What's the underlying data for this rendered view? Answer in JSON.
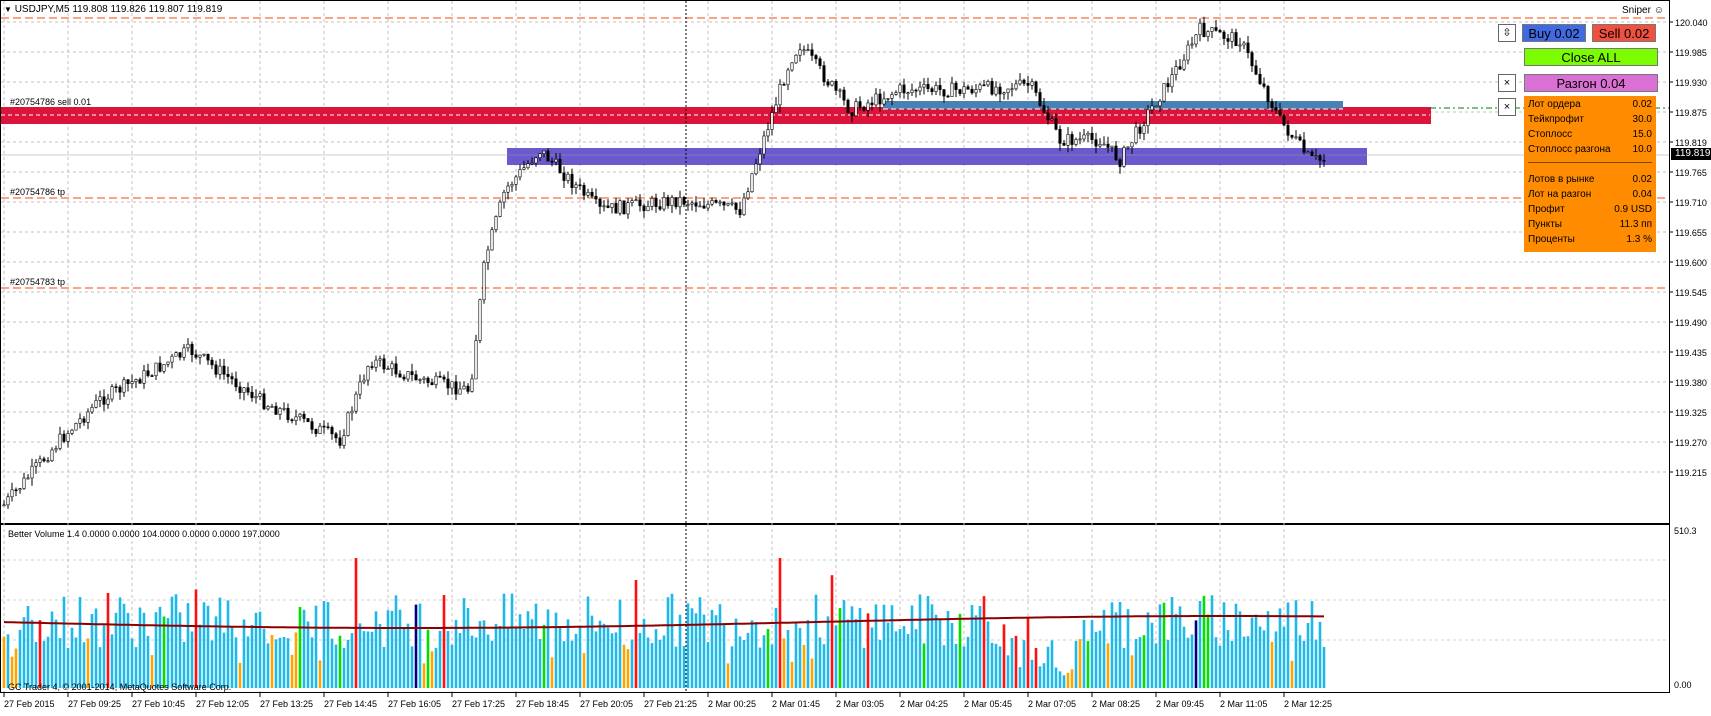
{
  "header": {
    "symbol_info": "USDJPY,M5  119.808 119.826 119.807 119.819",
    "expert_name": "Sniper"
  },
  "price_axis": {
    "labels": [
      "120.040",
      "119.985",
      "119.930",
      "119.875",
      "119.819",
      "119.765",
      "119.710",
      "119.655",
      "119.600",
      "119.545",
      "119.490",
      "119.435",
      "119.380",
      "119.325",
      "119.270",
      "119.215"
    ],
    "current_price": "119.819"
  },
  "time_axis": {
    "labels": [
      "27 Feb 2015",
      "27 Feb 09:25",
      "27 Feb 10:45",
      "27 Feb 12:05",
      "27 Feb 13:25",
      "27 Feb 14:45",
      "27 Feb 16:05",
      "27 Feb 17:25",
      "27 Feb 18:45",
      "27 Feb 20:05",
      "27 Feb 21:25",
      "2 Mar 00:25",
      "2 Mar 01:45",
      "2 Mar 03:05",
      "2 Mar 04:25",
      "2 Mar 05:45",
      "2 Mar 07:05",
      "2 Mar 08:25",
      "2 Mar 09:45",
      "2 Mar 11:05",
      "2 Mar 12:25"
    ]
  },
  "order_labels": {
    "sell_order": "#20754786 sell 0.01",
    "tp_1": "#20754786 tp",
    "tp_2": "#20754783 tp"
  },
  "volume_indicator": {
    "title": "Better Volume 1.4 0.0000 0.0000 104.0000 0.0000 0.0000 197.0000",
    "max_label": "510.3",
    "min_label": "0.00",
    "copyright": "GC Trader 4, © 2001-2014, MetaQuotes Software Corp."
  },
  "trade_panel": {
    "buy_label": "Buy 0.02",
    "sell_label": "Sell 0.02",
    "close_all_label": "Close ALL",
    "razgon_label": "Разгон 0.04",
    "close_x": "×",
    "arrows_icon": "⇳"
  },
  "info_panel": {
    "rows_top": [
      {
        "label": "Лот ордера",
        "value": "0.02"
      },
      {
        "label": "Тейкпрофит",
        "value": "30.0"
      },
      {
        "label": "Стоплосс",
        "value": "15.0"
      },
      {
        "label": "Стоплосс разгона",
        "value": "10.0"
      }
    ],
    "rows_bottom": [
      {
        "label": "Лотов в рынке",
        "value": "0.02"
      },
      {
        "label": "Лот на разгон",
        "value": "0.04"
      },
      {
        "label": "Профит",
        "value": "0.9 USD"
      },
      {
        "label": "Пункты",
        "value": "11.3 пп"
      },
      {
        "label": "Проценты",
        "value": "1.3 %"
      }
    ]
  },
  "colors": {
    "bull_candle": "#000000",
    "sell_zone": "#dc143c",
    "buy_zone": "#6a5acd",
    "level_zone": "#4682b4",
    "tp_line": "#ff4500",
    "volume_normal": "#1fb8e8",
    "volume_climax": "#ff1010",
    "volume_low": "#ffa500",
    "volume_churn": "#00e000",
    "volume_dark": "#000080",
    "volume_ma": "#8b0000",
    "buy_btn": "#4169e1",
    "sell_btn": "#f05040",
    "close_btn": "#7cfc00",
    "razgon_btn": "#da70d6",
    "info_bg": "#ff8c00"
  }
}
